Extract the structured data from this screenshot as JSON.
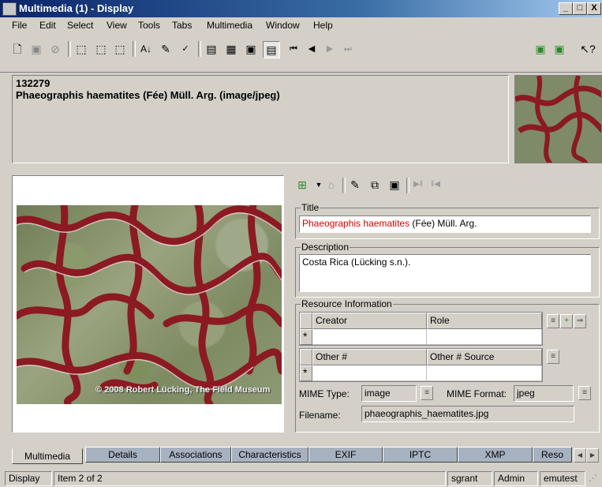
{
  "window": {
    "title": "Multimedia (1) - Display",
    "buttons": [
      "_",
      "□",
      "X"
    ]
  },
  "menu": [
    "File",
    "Edit",
    "Select",
    "View",
    "Tools",
    "Tabs",
    "Multimedia",
    "Window",
    "Help"
  ],
  "header": {
    "irn": "132279",
    "summary": "Phaeographis haematites (Fée) Müll. Arg. (image/jpeg)"
  },
  "image": {
    "copyright": "© 2008 Robert Lücking, The Field Museum"
  },
  "form": {
    "title_label": "Title",
    "title_value_red": "Phaeographis haematites",
    "title_value_rest": " (Fée) Müll. Arg.",
    "description_label": "Description",
    "description_value": "Costa Rica (Lücking s.n.).",
    "resource_label": "Resource Information",
    "col_creator": "Creator",
    "col_role": "Role",
    "col_other": "Other #",
    "col_other_source": "Other # Source",
    "new_row_marker": "*",
    "mime_type_label": "MIME Type:",
    "mime_type_value": "image",
    "mime_format_label": "MIME Format:",
    "mime_format_value": "jpeg",
    "filename_label": "Filename:",
    "filename_value": "phaeographis_haematites.jpg"
  },
  "tabs": [
    "Multimedia",
    "Details",
    "Associations",
    "Characteristics",
    "EXIF",
    "IPTC",
    "XMP",
    "Reso"
  ],
  "status": {
    "mode": "Display",
    "item": "Item 2 of 2",
    "user": "sgrant",
    "group": "Admin",
    "db": "emutest"
  },
  "colors": {
    "titlebar": "#0a246a",
    "tab_inactive": "#a7b2c0",
    "required_text": "#e00000",
    "lichen_red": "#8b1a22"
  }
}
